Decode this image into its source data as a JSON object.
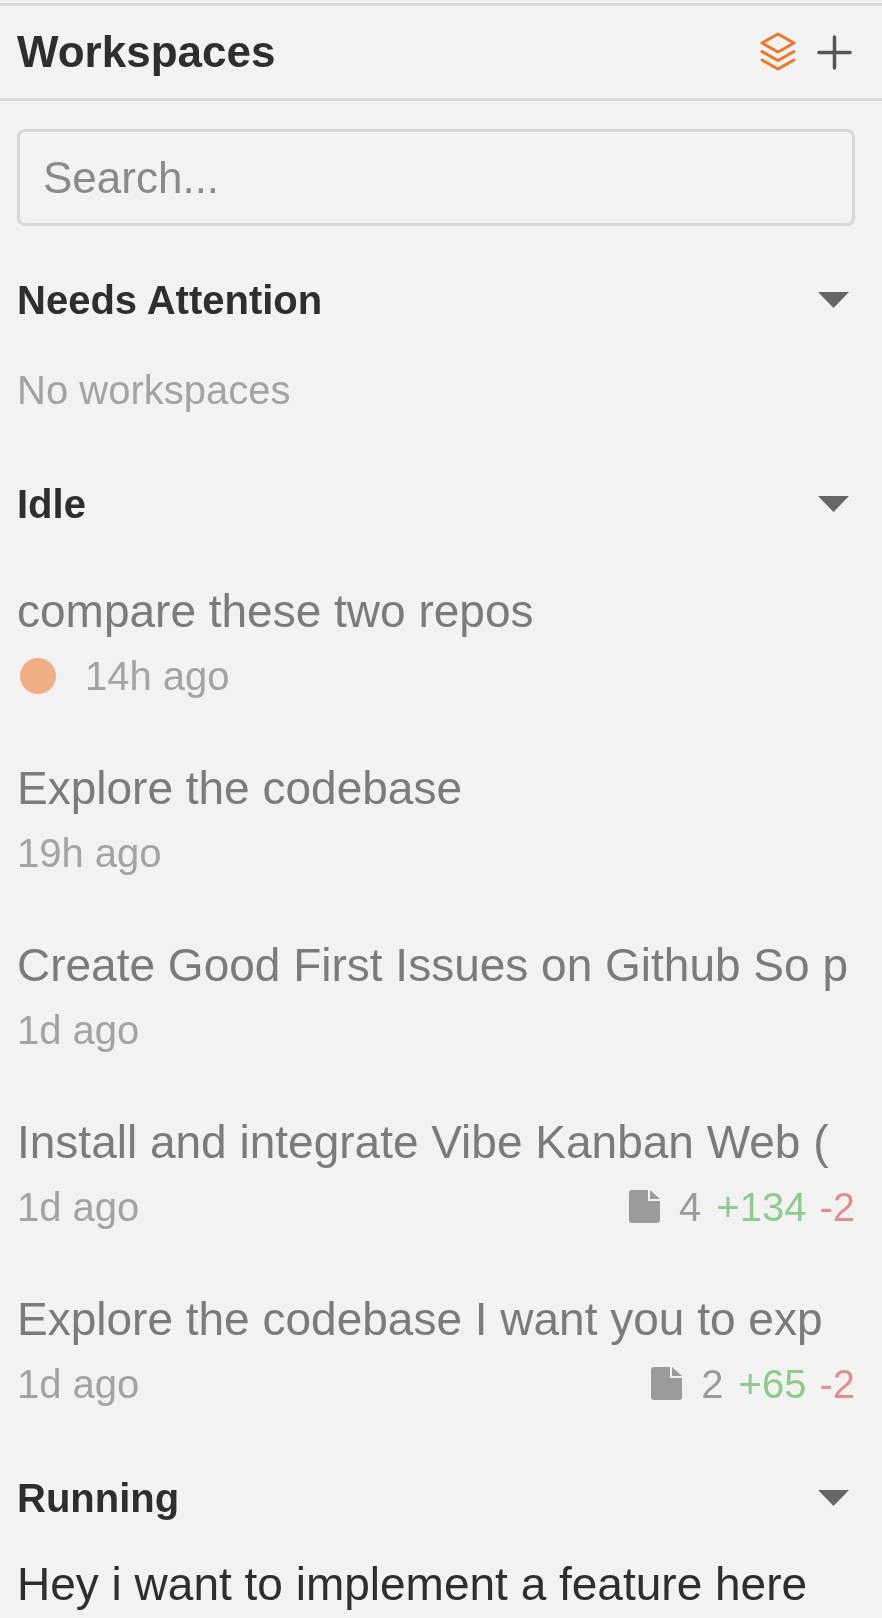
{
  "header": {
    "title": "Workspaces"
  },
  "search": {
    "placeholder": "Search..."
  },
  "sections": [
    {
      "title": "Needs Attention",
      "expanded": true,
      "empty_text": "No workspaces"
    },
    {
      "title": "Idle",
      "expanded": true,
      "workspaces": [
        {
          "title": "compare these two repos",
          "time": "14h ago",
          "color": "#f0ae85",
          "selected": false
        },
        {
          "title": "Explore the codebase",
          "time": "19h ago",
          "selected": false
        },
        {
          "title": "Create Good First Issues on Github So p",
          "time": "1d ago",
          "selected": false
        },
        {
          "title": "Install and integrate Vibe Kanban Web (",
          "time": "1d ago",
          "selected": false,
          "stats": {
            "files": "4",
            "added": "+134",
            "removed": "-2"
          }
        },
        {
          "title": "Explore the codebase I want you to exp",
          "time": "1d ago",
          "selected": false,
          "stats": {
            "files": "2",
            "added": "+65",
            "removed": "-2"
          }
        }
      ]
    },
    {
      "title": "Running",
      "expanded": true,
      "workspaces": [
        {
          "title": "Hey i want to implement a feature here",
          "selected": true
        }
      ]
    }
  ]
}
